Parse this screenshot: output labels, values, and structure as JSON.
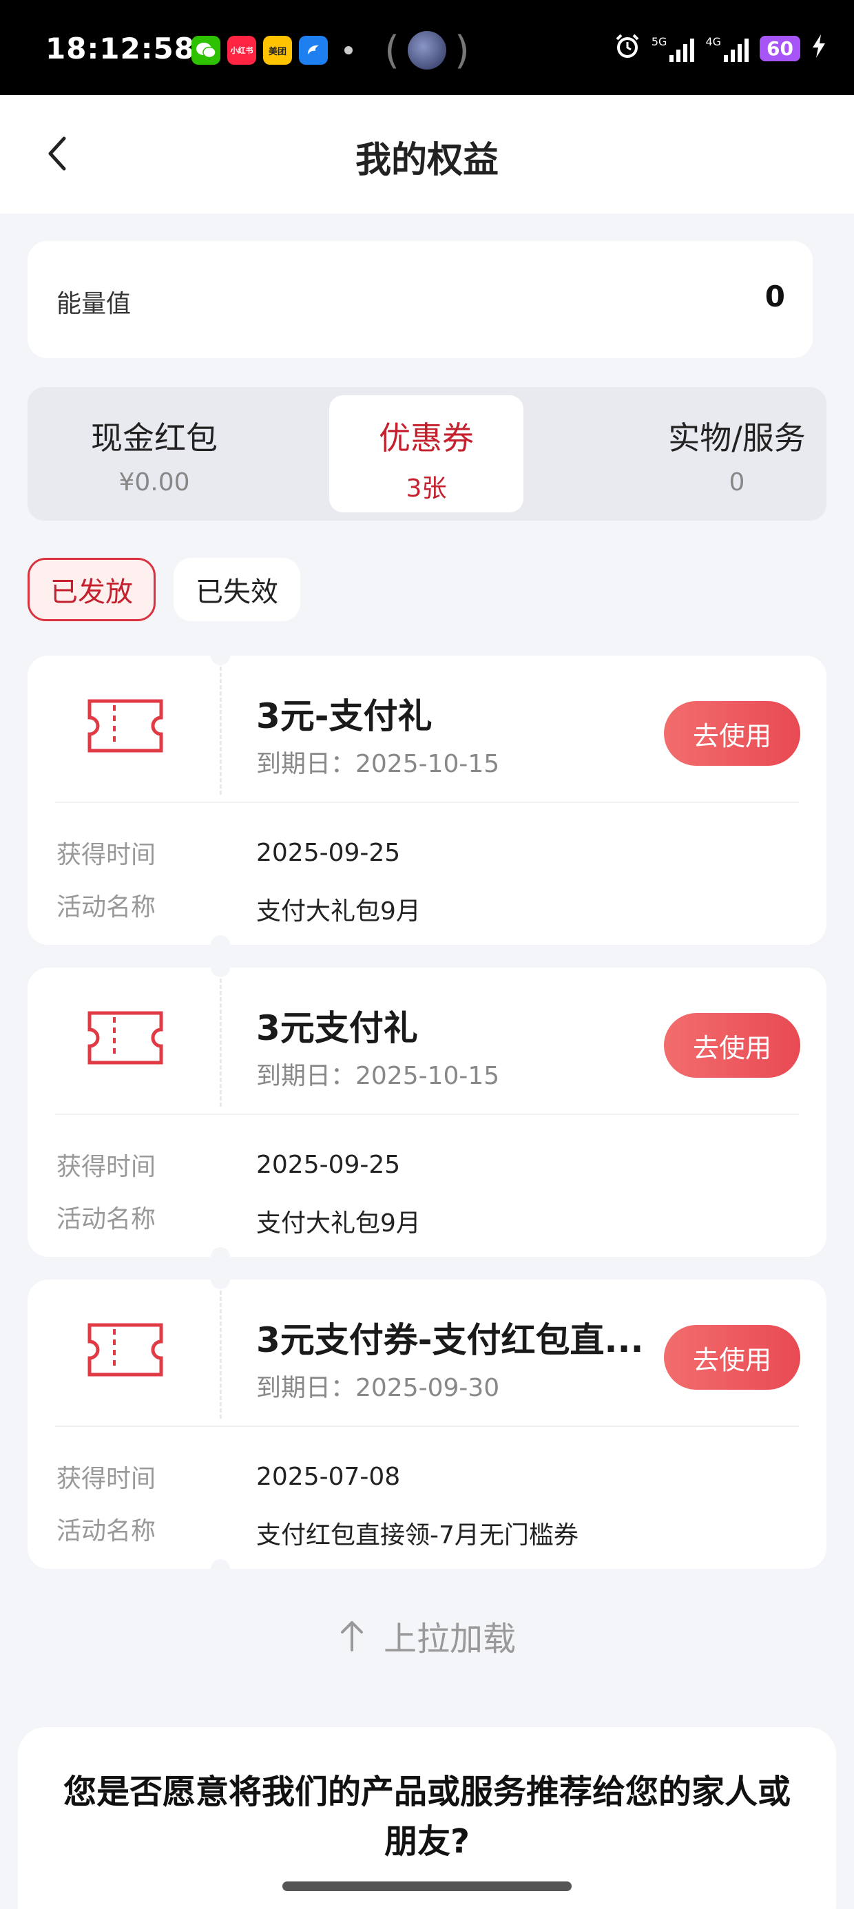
{
  "status_bar": {
    "time": "18:12:58",
    "apps": [
      {
        "name": "wechat-icon",
        "label": "",
        "color": "#2dc100"
      },
      {
        "name": "xiaohongshu-icon",
        "label": "小红书",
        "color": "#ff2442"
      },
      {
        "name": "meituan-icon",
        "label": "美团",
        "color": "#ffc300"
      },
      {
        "name": "browser-icon",
        "label": "",
        "color": "#1e7ff0"
      }
    ],
    "network_1": "5G",
    "network_2": "4G",
    "battery": "60"
  },
  "header": {
    "title": "我的权益"
  },
  "energy": {
    "label": "能量值",
    "value": "0"
  },
  "tabs": [
    {
      "label": "现金红包",
      "sub": "¥0.00"
    },
    {
      "label": "优惠券",
      "sub": "3张"
    },
    {
      "label": "实物/服务",
      "sub": "0"
    }
  ],
  "filters": {
    "issued": "已发放",
    "expired": "已失效"
  },
  "coupons": [
    {
      "title": "3元-支付礼",
      "expiry": "到期日：2025-10-15",
      "button": "去使用",
      "obtained_label": "获得时间",
      "obtained_value": "2025-09-25",
      "activity_label": "活动名称",
      "activity_value": "支付大礼包9月"
    },
    {
      "title": "3元支付礼",
      "expiry": "到期日：2025-10-15",
      "button": "去使用",
      "obtained_label": "获得时间",
      "obtained_value": "2025-09-25",
      "activity_label": "活动名称",
      "activity_value": "支付大礼包9月"
    },
    {
      "title": "3元支付券-支付红包直...",
      "expiry": "到期日：2025-09-30",
      "button": "去使用",
      "obtained_label": "获得时间",
      "obtained_value": "2025-07-08",
      "activity_label": "活动名称",
      "activity_value": "支付红包直接领-7月无门槛券"
    }
  ],
  "load_more": "上拉加载",
  "survey": {
    "question": "您是否愿意将我们的产品或服务推荐给您的家人或朋友?"
  },
  "colors": {
    "accent": "#c4202d",
    "button_gradient_start": "#f26d6d",
    "button_gradient_end": "#e84a53",
    "page_bg": "#f4f5f9"
  }
}
